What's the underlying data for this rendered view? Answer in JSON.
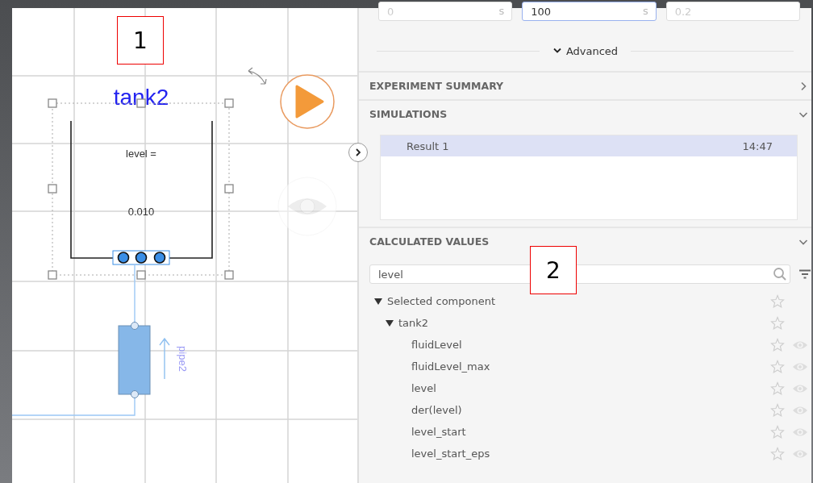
{
  "diagram": {
    "component": {
      "name": "tank2",
      "value_label": "level =",
      "value": "0.010",
      "selected": true
    },
    "pipe": {
      "name": "pipe2"
    }
  },
  "fields": [
    {
      "placeholder": "0",
      "unit": "s",
      "focused": false
    },
    {
      "value": "100",
      "unit": "s",
      "focused": true
    },
    {
      "placeholder": "0.2",
      "focused": false
    }
  ],
  "advanced": {
    "label": "Advanced",
    "expanded": false
  },
  "sections": [
    {
      "title": "EXPERIMENT SUMMARY",
      "expanded": false
    },
    {
      "title": "SIMULATIONS",
      "expanded": true
    },
    {
      "title": "CALCULATED VALUES",
      "expanded": true
    }
  ],
  "simulations": [
    {
      "label": "Result 1",
      "time": "14:47",
      "selected": true
    }
  ],
  "search": {
    "value": "level"
  },
  "tree": [
    {
      "label": "Selected component",
      "expanded": true,
      "children": [
        {
          "label": "tank2",
          "expanded": true,
          "children": [
            {
              "label": "fluidLevel"
            },
            {
              "label": "fluidLevel_max"
            },
            {
              "label": "level"
            },
            {
              "label": "der(level)"
            },
            {
              "label": "level_start"
            },
            {
              "label": "level_start_eps"
            }
          ]
        }
      ]
    }
  ],
  "callouts": [
    {
      "label": "1"
    },
    {
      "label": "2"
    }
  ]
}
